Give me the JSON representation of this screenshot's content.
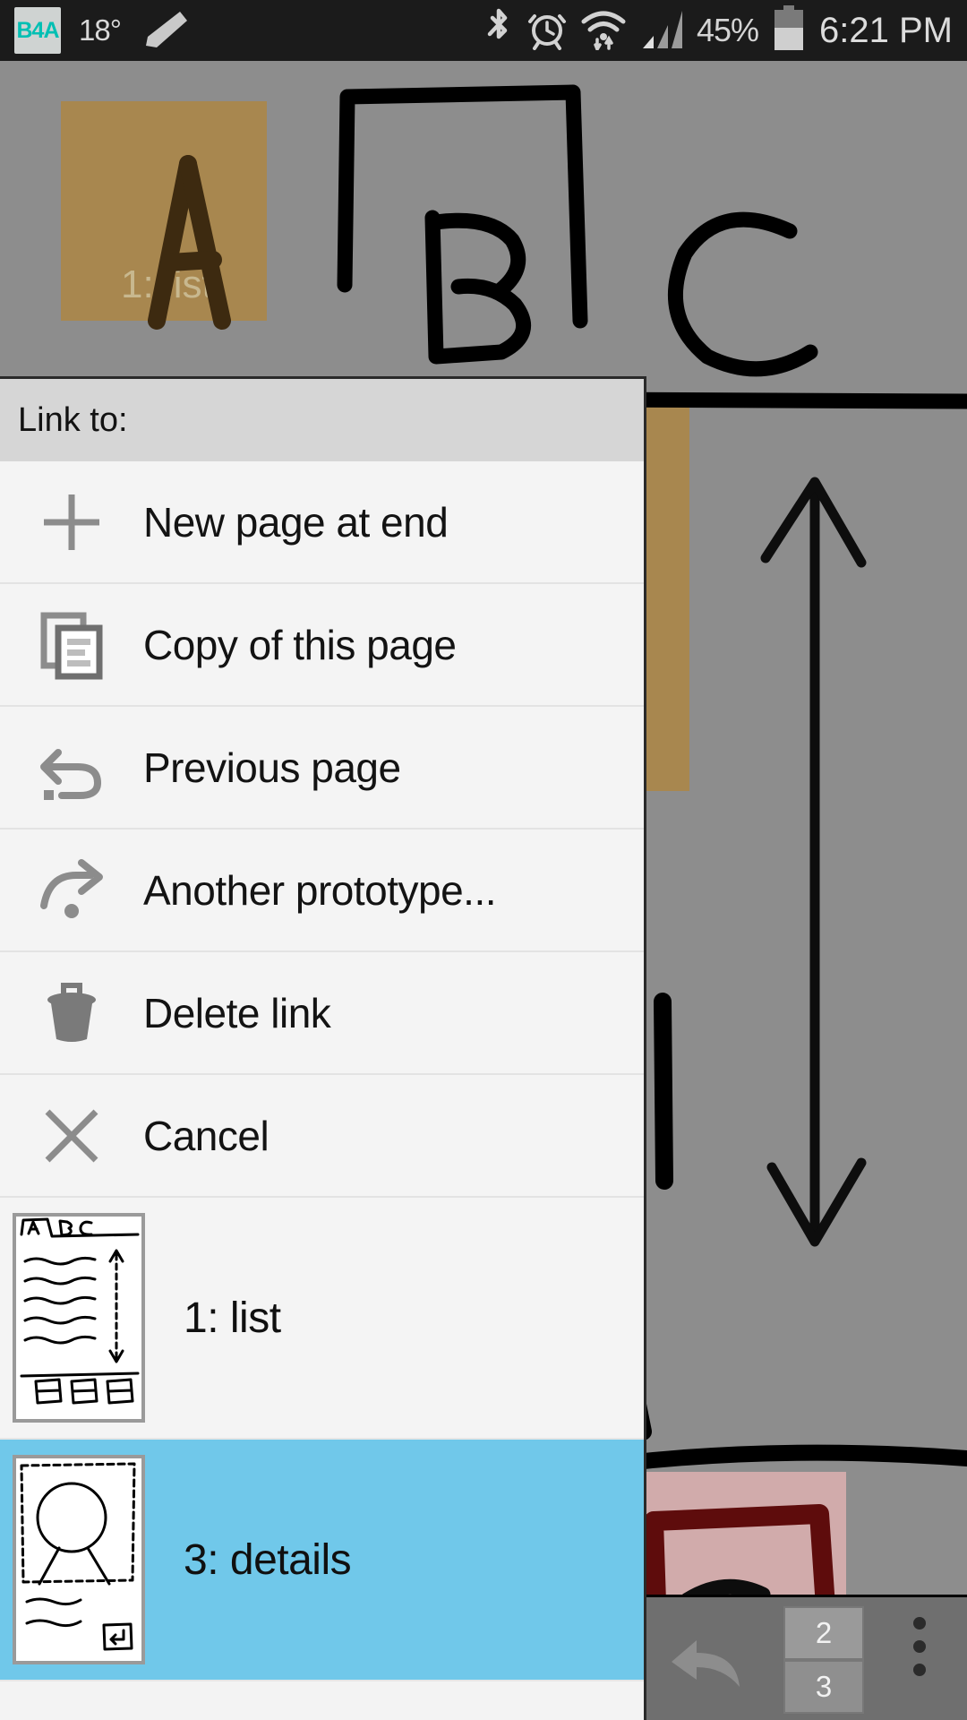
{
  "statusbar": {
    "app_badge": "B4A",
    "temperature": "18°",
    "pen_icon": "pen-icon",
    "bluetooth_icon": "bluetooth-icon",
    "alarm_icon": "alarm-icon",
    "wifi_icon": "wifi-icon",
    "signal_icon": "signal-icon",
    "battery_percent": "45%",
    "battery_icon": "battery-icon",
    "time": "6:21 PM"
  },
  "canvas": {
    "page_title_overlay": "1: list",
    "description": "hand-drawn ABC tabs wireframe sketch"
  },
  "dialog": {
    "title": "Link to:",
    "menu_items": [
      {
        "icon": "plus-icon",
        "label": "New page at end"
      },
      {
        "icon": "copy-icon",
        "label": "Copy of this page"
      },
      {
        "icon": "undo-arrow-icon",
        "label": "Previous page"
      },
      {
        "icon": "redo-arrow-icon",
        "label": "Another prototype..."
      },
      {
        "icon": "trash-icon",
        "label": "Delete link"
      },
      {
        "icon": "close-x-icon",
        "label": "Cancel"
      }
    ],
    "pages": [
      {
        "label": "1: list",
        "thumbnail": "list-wireframe-thumbnail",
        "selected": false
      },
      {
        "label": "3: details",
        "thumbnail": "details-wireframe-thumbnail",
        "selected": true
      }
    ]
  },
  "bottombar": {
    "undo_icon": "undo-icon",
    "page_top": "2",
    "page_bottom": "3",
    "overflow_icon": "overflow-menu-icon"
  },
  "colors": {
    "selection": "#70c8ea",
    "canvas": "#8d8d8d",
    "dialog_bg": "#f3f3f3",
    "accent_badge": "#00bfb3"
  }
}
